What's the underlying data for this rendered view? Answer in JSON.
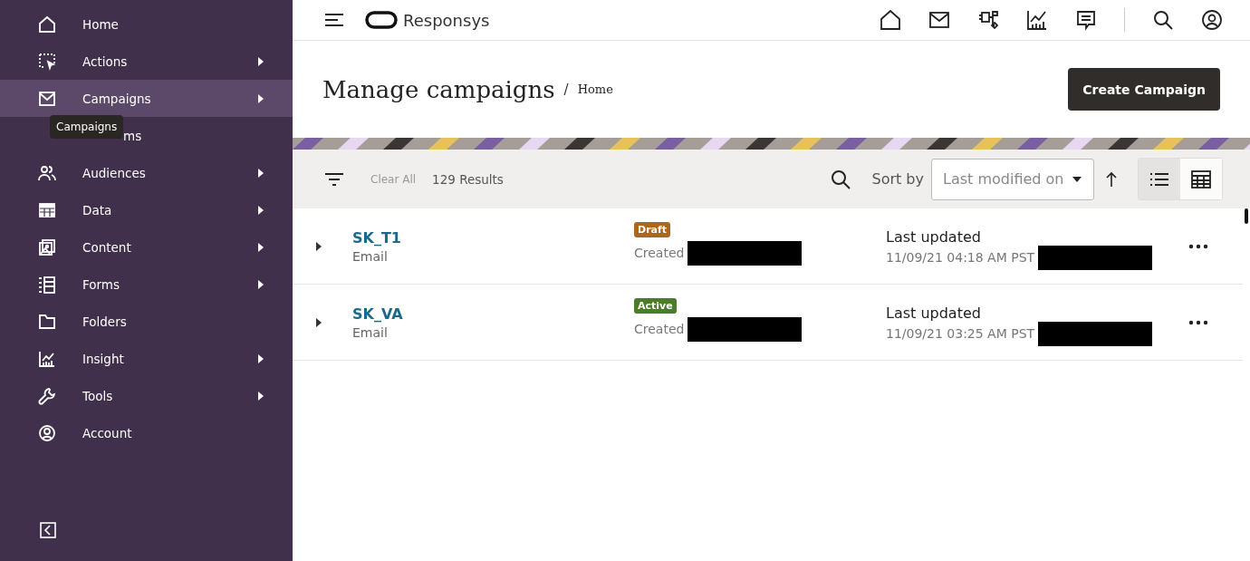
{
  "sidebar": {
    "items": [
      {
        "label": "Home",
        "submenu": false,
        "selected": false,
        "covered": false
      },
      {
        "label": "Actions",
        "submenu": true,
        "selected": false,
        "covered": false
      },
      {
        "label": "Campaigns",
        "submenu": true,
        "selected": true,
        "covered": false
      },
      {
        "label": "ms",
        "submenu": false,
        "selected": false,
        "covered": true
      },
      {
        "label": "Audiences",
        "submenu": true,
        "selected": false,
        "covered": false
      },
      {
        "label": "Data",
        "submenu": true,
        "selected": false,
        "covered": false
      },
      {
        "label": "Content",
        "submenu": true,
        "selected": false,
        "covered": false
      },
      {
        "label": "Forms",
        "submenu": true,
        "selected": false,
        "covered": false
      },
      {
        "label": "Folders",
        "submenu": false,
        "selected": false,
        "covered": false
      },
      {
        "label": "Insight",
        "submenu": true,
        "selected": false,
        "covered": false
      },
      {
        "label": "Tools",
        "submenu": true,
        "selected": false,
        "covered": false
      },
      {
        "label": "Account",
        "submenu": false,
        "selected": false,
        "covered": false
      }
    ],
    "tooltip": "Campaigns"
  },
  "topbar": {
    "brand": "Responsys"
  },
  "header": {
    "title": "Manage campaigns",
    "separator": "/",
    "breadcrumb": "Home",
    "create_button": "Create Campaign"
  },
  "toolbar": {
    "clear_all": "Clear All",
    "results": "129 Results",
    "sort_label": "Sort by",
    "sort_value": "Last modified on",
    "view": [
      {
        "kind": "list",
        "selected": true
      },
      {
        "kind": "grid",
        "selected": false
      }
    ]
  },
  "campaigns": [
    {
      "name": "SK_T1",
      "type": "Email",
      "status": "Draft",
      "color": "#b0661a",
      "created_label": "Created",
      "updated_label": "Last updated",
      "updated": "11/09/21 04:18 AM PST"
    },
    {
      "name": "SK_VA",
      "type": "Email",
      "status": "Active",
      "color": "#4a7c2a",
      "created_label": "Created",
      "updated_label": "Last updated",
      "updated": "11/09/21 03:25 AM PST"
    }
  ]
}
